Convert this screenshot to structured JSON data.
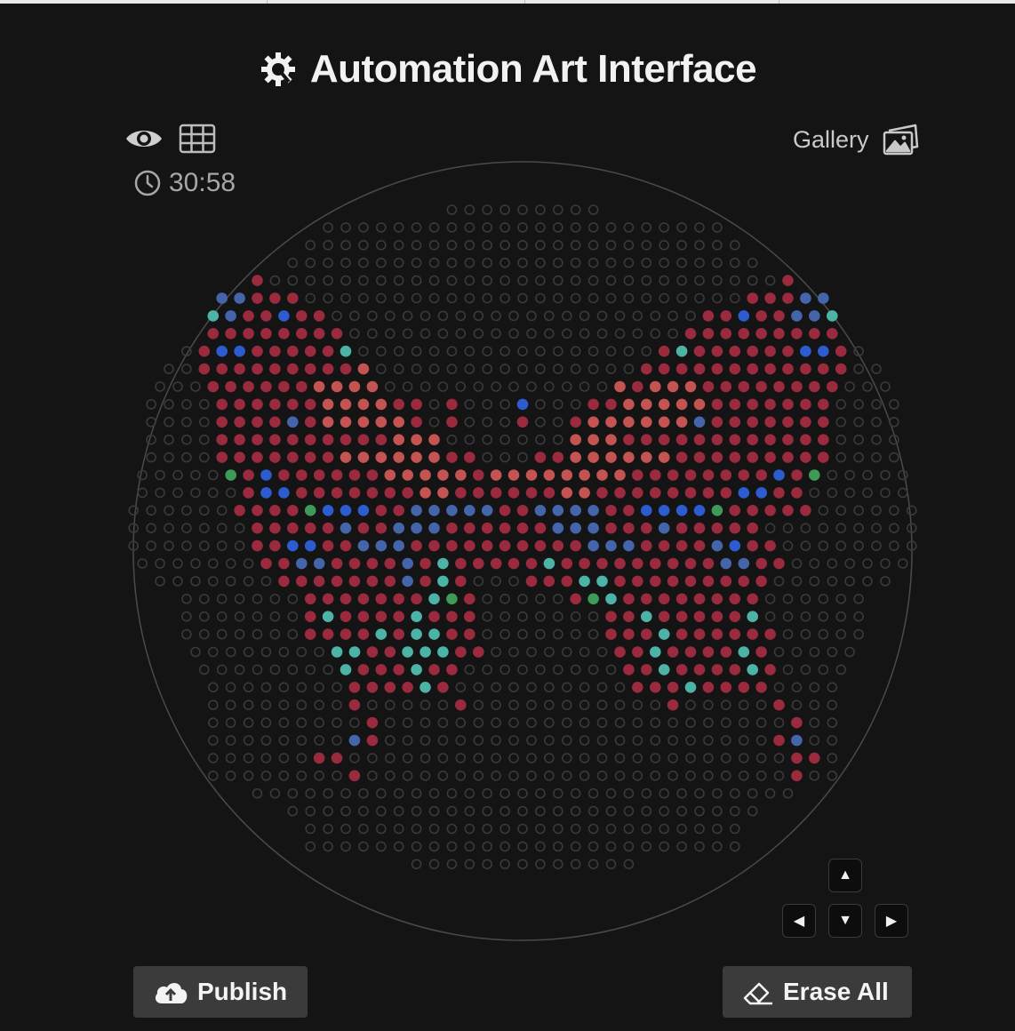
{
  "app": {
    "title": "Automation Art Interface"
  },
  "toolbar": {
    "timer": "30:58",
    "gallery_label": "Gallery"
  },
  "actions": {
    "publish_label": "Publish",
    "erase_label": "Erase All"
  },
  "nav": {
    "up": "▲",
    "left": "◀",
    "down": "▼",
    "right": "▶"
  },
  "icons": [
    "logo-icon",
    "eye-icon",
    "grid-icon",
    "clock-icon",
    "gallery-icon",
    "cloud-upload-icon",
    "eraser-icon"
  ],
  "colors": {
    "background": "#141414",
    "empty": "#3a3a3a",
    "crimson": "#9a2a3e",
    "salmon": "#c45451",
    "blue": "#2c5cd0",
    "slate_blue": "#4565ab",
    "teal": "#4db3a6",
    "green": "#3f9a58"
  },
  "art": {
    "legend": ". empty, r crimson, s salmon, b blue, l slate blue, t teal, g green",
    "rows": [
      ".........",
      ".......................",
      ".........................",
      "...........................",
      "r.............................r",
      "llrrr.........................rrrll",
      "tlrrbrr.....................rrbrrllt",
      "rrrrrrrr...................rrrrrrrrr",
      ".rbbrrrrrt.................rtrrrrrrbbr.",
      "..rrrrrrrrrs...............rrrrrrrrrrrr..",
      "...rrrrrrssss.............srsssrrrrrrrr...",
      "....rrrrrrssssrr.r...b...rrsssssrrrrrrr....",
      "....rrrrlrsssssr.r...r..rsssssslrrrrrrr....",
      "....rrrrrrrrrrsss.......sssrrrrrrrrrrrr....",
      "....rrrrrrrssssssrr...rrssssssrrrrrrrrr....",
      ".....grbrrrrrrsssssrssssssssrrrrrrrrbrg.....",
      "......rbbrrrrrrrssrrrrrrssrrrrrrrrbbrr......",
      "......rrrrgbbbrrlllllrrllllrrbbbbgrrrrr......",
      ".......rrrrrlrrlllrrrrrrlllrrrlrrrrr.........",
      ".......rrbbrrlllrrrrrrrrrrlllrrrrlbrr........",
      ".......rrllrrrrlrtrrrrrtrrrrrrrrrllrr.......",
      ".......rrrrrrrlrtr...rrrttrrrrrrrrr.......",
      ".......rrrrrrrtgr.....rgtrrrrrrrr......",
      ".......rtrrrrtrrr.......rrtrrrrrt......",
      ".......rrrrtrttrr.......rrrtrrrrrr.....",
      "........ttrrtttrr.......rrtrrrrtr.....",
      "........trrrtrr.........rrtrrrrtr....",
      "........rrrrtr..........rrrtrrrr....",
      "........r.....r...........r.....r...",
      ".........r.......................r..",
      "........lr......................rl..",
      "......rr.........................rr.",
      "........r........................r..",
      "...............................",
      "...........................",
      ".........................",
      ".........................",
      "............."
    ]
  }
}
